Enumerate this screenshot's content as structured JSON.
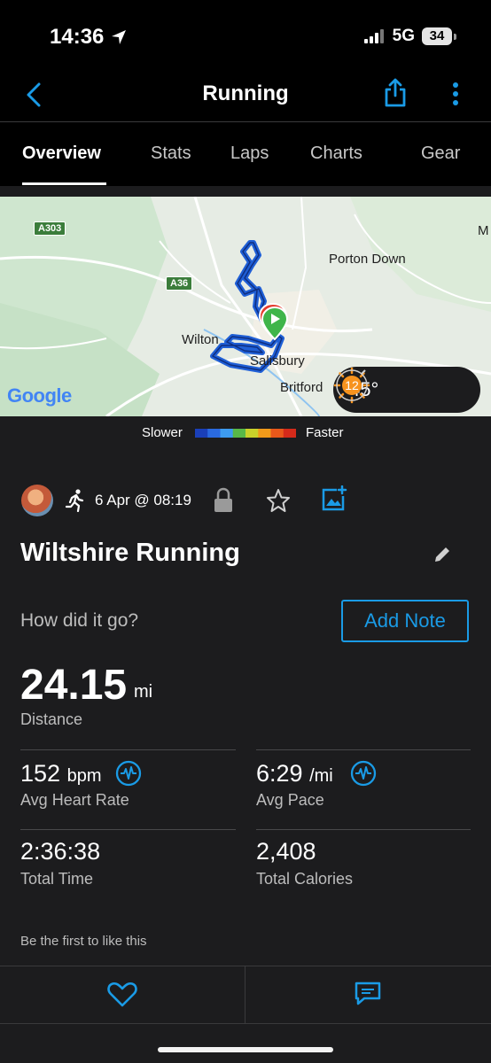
{
  "status_bar": {
    "time": "14:36",
    "network": "5G",
    "battery": "34"
  },
  "nav": {
    "title": "Running"
  },
  "tabs": [
    {
      "label": "Overview",
      "active": true
    },
    {
      "label": "Stats",
      "active": false
    },
    {
      "label": "Laps",
      "active": false
    },
    {
      "label": "Charts",
      "active": false
    },
    {
      "label": "Gear",
      "active": false
    }
  ],
  "map": {
    "labels": {
      "a303": "A303",
      "a36": "A36",
      "porton_down": "Porton Down",
      "wilton": "Wilton",
      "salisbury": "Salisbury",
      "britford": "Britford",
      "m": "M",
      "google": "Google"
    },
    "weather": {
      "temperature": "45°",
      "wind_speed": "12"
    }
  },
  "pace_legend": {
    "slower": "Slower",
    "faster": "Faster",
    "colors": [
      "#1a3fb8",
      "#2a6ae0",
      "#3d9bf0",
      "#58b848",
      "#c9d12a",
      "#f09a1a",
      "#e8581a",
      "#d42a1a"
    ]
  },
  "activity": {
    "date": "6 Apr @ 08:19",
    "title": "Wiltshire Running",
    "prompt": "How did it go?",
    "add_note": "Add Note"
  },
  "distance": {
    "value": "24.15",
    "unit": "mi",
    "label": "Distance"
  },
  "stats": {
    "avg_hr": {
      "value": "152",
      "unit": "bpm",
      "label": "Avg Heart Rate"
    },
    "avg_pace": {
      "value": "6:29",
      "unit": "/mi",
      "label": "Avg Pace"
    },
    "total_time": {
      "value": "2:36:38",
      "label": "Total Time"
    },
    "total_calories": {
      "value": "2,408",
      "label": "Total Calories"
    }
  },
  "social": {
    "likes_text": "Be the first to like this"
  },
  "colors": {
    "accent": "#1a9be6",
    "background": "#1c1c1e",
    "header": "#000000",
    "start_marker": "#3fb54a",
    "route": "#1f5fd6"
  }
}
